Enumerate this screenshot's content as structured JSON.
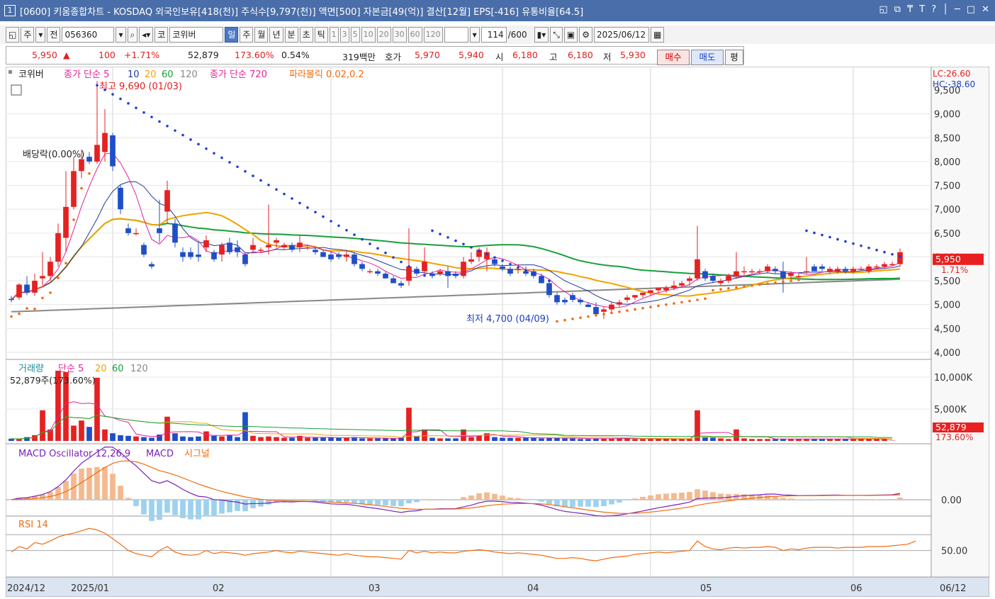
{
  "title_bar": {
    "window_number": "1",
    "title": "[0600] 키움종합차트 - KOSDAQ 외국인보유[418(천)] 주식수[9,797(천)] 액면[500] 자본금[49(억)] 결산[12월] EPS[-416] 유통비율[64.5]",
    "controls": [
      "◱",
      "⧉",
      "₸",
      "T",
      "?",
      "│",
      "─",
      "□",
      "✕"
    ]
  },
  "toolbar": {
    "mode": "주",
    "prev_label": "전",
    "stock_code": "056360",
    "market_label": "코",
    "stock_name": "코위버",
    "periods": [
      "일",
      "주",
      "월",
      "년",
      "분",
      "초",
      "틱"
    ],
    "selected_period": "일",
    "intervals": [
      "1",
      "3",
      "5",
      "10",
      "20",
      "30",
      "60",
      "120"
    ],
    "count": "114",
    "count_max": "/600",
    "date": "2025/06/12"
  },
  "quote": {
    "price": "5,950",
    "arrow": "▲",
    "change": "100",
    "change_pct": "+1.71%",
    "volume": "52,879",
    "volume_ratio": "173.60%",
    "turnover": "0.54%",
    "amount": "319백만",
    "ask_label": "호가",
    "ask": "5,970",
    "bid": "5,940",
    "open_label": "시",
    "open": "6,180",
    "high_label": "고",
    "high": "6,180",
    "low_label": "저",
    "low": "5,930",
    "buy_label": "매수",
    "sell_label": "매도",
    "avg_label": "평"
  },
  "colors": {
    "up": "#e52121",
    "down": "#1f4fc8",
    "ma5": "#e0249a",
    "ma10": "#1f3a99",
    "ma20": "#f0a300",
    "ma60": "#18a03a",
    "ma120": "#888888",
    "sar": "#1f3dd6",
    "sar_up": "#f26b10"
  },
  "price_panel": {
    "legend": [
      "코위버",
      "종가 단순 5",
      "10",
      "20",
      "60",
      "120",
      "종가 단순 720",
      "파라볼릭 0.02,0.2"
    ],
    "high_note": "최고 9,690 (01/03)",
    "low_note": "최저 4,700 (04/09)",
    "dividend_note": "배당락(0.00%)",
    "lc": "LC:26.60",
    "hc": "HC:-38.60",
    "y_ticks": [
      "9,500",
      "9,000",
      "8,500",
      "8,000",
      "7,500",
      "7,000",
      "6,500",
      "6,000",
      "5,500",
      "5,000",
      "4,500",
      "4,000"
    ],
    "price_tag": "5,950",
    "pct_tag": "1.71%"
  },
  "volume_panel": {
    "legend": [
      "거래량",
      "단순 5",
      "20",
      "60",
      "120"
    ],
    "note": "52,879주(173.60%)",
    "y_ticks": [
      "10,000K",
      "5,000K"
    ],
    "tag": "52,879",
    "tag_pct": "173.60%"
  },
  "macd_panel": {
    "legend": [
      "MACD Oscillator 12,26,9",
      "MACD",
      "시그널"
    ],
    "y_ticks": [
      "0.00"
    ]
  },
  "rsi_panel": {
    "legend": [
      "RSI 14"
    ],
    "y_ticks": [
      "50.00"
    ]
  },
  "x_axis": {
    "labels": [
      "2024/12",
      "2025/01",
      "02",
      "03",
      "04",
      "05",
      "06"
    ],
    "right_label": "06/12"
  },
  "chart_data": {
    "type": "candlestick",
    "x_start": "2024/12",
    "x_end": "06/12",
    "ylim": [
      4000,
      9500
    ],
    "high": {
      "value": 9690,
      "date": "01/03"
    },
    "low": {
      "value": 4700,
      "date": "04/09"
    },
    "candles": [
      [
        5120,
        5180,
        5050,
        5100
      ],
      [
        5150,
        5450,
        5100,
        5420
      ],
      [
        5420,
        5600,
        5200,
        5250
      ],
      [
        5250,
        5650,
        5180,
        5500
      ],
      [
        5550,
        6100,
        5400,
        5600
      ],
      [
        5600,
        6000,
        5500,
        5900
      ],
      [
        5900,
        6700,
        5800,
        6500
      ],
      [
        6400,
        7800,
        6100,
        7050
      ],
      [
        7050,
        8100,
        7000,
        7800
      ],
      [
        7800,
        8250,
        7650,
        8050
      ],
      [
        8100,
        8200,
        7950,
        8000
      ],
      [
        8000,
        9690,
        7950,
        8350
      ],
      [
        8200,
        9100,
        8000,
        8600
      ],
      [
        8550,
        8600,
        7800,
        7900
      ],
      [
        7450,
        7500,
        6900,
        7000
      ],
      [
        6600,
        6700,
        6450,
        6500
      ],
      [
        6500,
        6600,
        6450,
        6500
      ],
      [
        6250,
        6300,
        6000,
        6050
      ],
      [
        5850,
        5900,
        5750,
        5800
      ],
      [
        6600,
        7200,
        6300,
        6500
      ],
      [
        6950,
        7600,
        6700,
        7400
      ],
      [
        6700,
        6800,
        6200,
        6300
      ],
      [
        6100,
        6200,
        5900,
        6000
      ],
      [
        6100,
        6200,
        5950,
        6000
      ],
      [
        6050,
        6300,
        5900,
        6000
      ],
      [
        6200,
        6450,
        6100,
        6350
      ],
      [
        6100,
        6150,
        5900,
        5950
      ],
      [
        6050,
        6300,
        5900,
        6250
      ],
      [
        6300,
        6400,
        6050,
        6100
      ],
      [
        6200,
        6350,
        6000,
        6100
      ],
      [
        6050,
        6100,
        5800,
        5850
      ],
      [
        6150,
        6400,
        6100,
        6250
      ],
      [
        6150,
        6200,
        6100,
        6150
      ],
      [
        6200,
        7100,
        6050,
        6250
      ],
      [
        6300,
        6400,
        6200,
        6350
      ],
      [
        6200,
        6300,
        6150,
        6250
      ],
      [
        6250,
        6300,
        6100,
        6150
      ],
      [
        6200,
        6450,
        6100,
        6300
      ],
      [
        6200,
        6250,
        6150,
        6200
      ],
      [
        6150,
        6200,
        6050,
        6100
      ],
      [
        6100,
        6150,
        6000,
        6000
      ],
      [
        6050,
        6100,
        5900,
        5950
      ],
      [
        6050,
        6100,
        5950,
        6000
      ],
      [
        6000,
        6150,
        5900,
        6050
      ],
      [
        6050,
        6100,
        5800,
        5850
      ],
      [
        5850,
        5900,
        5700,
        5750
      ],
      [
        5700,
        5750,
        5650,
        5700
      ],
      [
        5700,
        5750,
        5600,
        5650
      ],
      [
        5650,
        5700,
        5550,
        5550
      ],
      [
        5550,
        5600,
        5450,
        5450
      ],
      [
        5450,
        5500,
        5350,
        5400
      ],
      [
        5500,
        6600,
        5400,
        5800
      ],
      [
        5750,
        5800,
        5600,
        5650
      ],
      [
        5700,
        6200,
        5650,
        5900
      ],
      [
        5650,
        5700,
        5550,
        5600
      ],
      [
        5650,
        5750,
        5600,
        5700
      ],
      [
        5700,
        5800,
        5350,
        5600
      ],
      [
        5650,
        5700,
        5550,
        5600
      ],
      [
        5600,
        6000,
        5550,
        5900
      ],
      [
        5900,
        6100,
        5850,
        5950
      ],
      [
        6000,
        6200,
        5900,
        6150
      ],
      [
        5950,
        6200,
        5700,
        6100
      ],
      [
        5950,
        6000,
        5800,
        5850
      ],
      [
        5800,
        5850,
        5700,
        5750
      ],
      [
        5750,
        5800,
        5600,
        5650
      ],
      [
        5750,
        5850,
        5650,
        5750
      ],
      [
        5700,
        5800,
        5600,
        5650
      ],
      [
        5700,
        5750,
        5550,
        5600
      ],
      [
        5600,
        5650,
        5450,
        5450
      ],
      [
        5450,
        5500,
        5150,
        5200
      ],
      [
        5200,
        5250,
        5000,
        5050
      ],
      [
        5100,
        5150,
        5000,
        5050
      ],
      [
        5200,
        5250,
        5050,
        5100
      ],
      [
        5100,
        5150,
        5000,
        5050
      ],
      [
        5000,
        5050,
        4950,
        4950
      ],
      [
        4950,
        5050,
        4750,
        4800
      ],
      [
        4850,
        4950,
        4700,
        4900
      ],
      [
        4900,
        5050,
        4850,
        5000
      ],
      [
        5000,
        5100,
        4950,
        5050
      ],
      [
        5100,
        5200,
        5050,
        5150
      ],
      [
        5150,
        5200,
        5100,
        5200
      ],
      [
        5200,
        5250,
        5150,
        5250
      ],
      [
        5250,
        5300,
        5200,
        5300
      ],
      [
        5300,
        5350,
        5250,
        5350
      ],
      [
        5300,
        5400,
        5250,
        5350
      ],
      [
        5350,
        5500,
        5300,
        5400
      ],
      [
        5400,
        5500,
        5350,
        5450
      ],
      [
        5500,
        5600,
        5400,
        5550
      ],
      [
        5550,
        6650,
        5500,
        5950
      ],
      [
        5700,
        5750,
        5500,
        5550
      ],
      [
        5600,
        5650,
        5450,
        5500
      ],
      [
        5450,
        5550,
        5400,
        5500
      ],
      [
        5500,
        5650,
        5450,
        5600
      ],
      [
        5600,
        6100,
        5550,
        5700
      ],
      [
        5700,
        5800,
        5600,
        5700
      ],
      [
        5700,
        5750,
        5650,
        5700
      ],
      [
        5700,
        5750,
        5650,
        5700
      ],
      [
        5700,
        5850,
        5650,
        5800
      ],
      [
        5750,
        5800,
        5650,
        5700
      ],
      [
        5700,
        5900,
        5250,
        5550
      ],
      [
        5600,
        5700,
        5550,
        5650
      ],
      [
        5600,
        5650,
        5550,
        5600
      ],
      [
        5700,
        6000,
        5650,
        5700
      ],
      [
        5800,
        5850,
        5700,
        5700
      ],
      [
        5800,
        5850,
        5700,
        5750
      ],
      [
        5700,
        5800,
        5650,
        5750
      ],
      [
        5700,
        5800,
        5650,
        5750
      ],
      [
        5750,
        5800,
        5650,
        5700
      ],
      [
        5700,
        5800,
        5650,
        5750
      ],
      [
        5750,
        5800,
        5700,
        5750
      ],
      [
        5700,
        5850,
        5650,
        5800
      ],
      [
        5800,
        5850,
        5750,
        5800
      ],
      [
        5800,
        5900,
        5750,
        5850
      ],
      [
        5850,
        5900,
        5800,
        5850
      ],
      [
        5850,
        6180,
        5800,
        6100
      ]
    ],
    "volume": [
      350,
      280,
      600,
      900,
      4800,
      1800,
      11000,
      10800,
      2400,
      3200,
      2200,
      9900,
      1800,
      1200,
      900,
      800,
      700,
      600,
      500,
      1000,
      3800,
      1200,
      700,
      600,
      700,
      1500,
      800,
      700,
      900,
      600,
      4500,
      800,
      600,
      700,
      600,
      500,
      500,
      800,
      500,
      500,
      500,
      500,
      500,
      500,
      600,
      400,
      400,
      400,
      400,
      400,
      500,
      5200,
      700,
      1800,
      500,
      400,
      400,
      400,
      1800,
      600,
      800,
      1200,
      600,
      500,
      500,
      500,
      500,
      500,
      400,
      500,
      500,
      400,
      400,
      300,
      300,
      400,
      400,
      400,
      400,
      400,
      300,
      300,
      300,
      300,
      300,
      300,
      300,
      300,
      4800,
      600,
      500,
      400,
      300,
      1800,
      400,
      300,
      300,
      300,
      300,
      300,
      300,
      300,
      300,
      300,
      300,
      300,
      300,
      300,
      300,
      300,
      300,
      300,
      300,
      52.879
    ],
    "rsi": [
      48,
      55,
      52,
      60,
      58,
      62,
      67,
      70,
      72,
      75,
      78,
      76,
      72,
      65,
      58,
      50,
      46,
      44,
      42,
      50,
      55,
      48,
      45,
      44,
      45,
      50,
      46,
      48,
      47,
      46,
      44,
      46,
      47,
      48,
      50,
      48,
      47,
      49,
      48,
      47,
      46,
      45,
      44,
      46,
      44,
      43,
      42,
      42,
      41,
      40,
      39,
      50,
      47,
      49,
      47,
      48,
      47,
      47,
      49,
      50,
      51,
      50,
      48,
      47,
      46,
      47,
      46,
      45,
      44,
      42,
      40,
      40,
      41,
      40,
      38,
      37,
      39,
      41,
      42,
      43,
      45,
      46,
      47,
      48,
      47,
      48,
      49,
      50,
      62,
      55,
      52,
      51,
      53,
      54,
      53,
      54,
      54,
      55,
      54,
      50,
      52,
      51,
      53,
      54,
      54,
      54,
      53,
      54,
      54,
      54,
      55,
      55,
      55,
      56,
      57,
      58,
      62
    ]
  }
}
